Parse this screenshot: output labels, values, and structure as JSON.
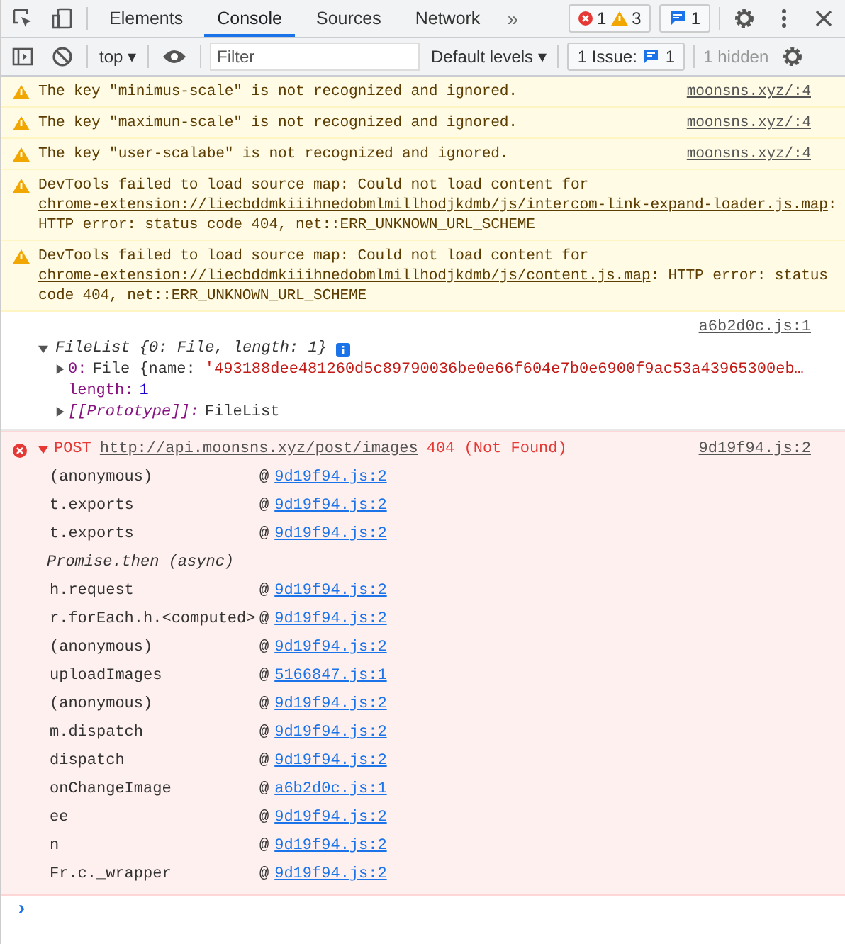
{
  "tabs": [
    {
      "label": "Elements",
      "selected": false
    },
    {
      "label": "Console",
      "selected": true
    },
    {
      "label": "Sources",
      "selected": false
    },
    {
      "label": "Network",
      "selected": false
    }
  ],
  "more_tabs": "»",
  "counters": {
    "errors": "1",
    "warnings": "3",
    "messages": "1"
  },
  "toolbar": {
    "context": "top",
    "context_caret": "▾",
    "filter_placeholder": "Filter",
    "levels": "Default levels",
    "levels_caret": "▾",
    "issues_label": "1 Issue:",
    "issues_count": "1",
    "hidden": "1 hidden"
  },
  "messages": [
    {
      "kind": "warning",
      "parts": [
        {
          "text": "The key \"minimus-scale\" is not recognized and ignored.",
          "link": false
        }
      ],
      "source": "moonsns.xyz/:4"
    },
    {
      "kind": "warning",
      "parts": [
        {
          "text": "The key \"maximun-scale\" is not recognized and ignored.",
          "link": false
        }
      ],
      "source": "moonsns.xyz/:4"
    },
    {
      "kind": "warning",
      "parts": [
        {
          "text": "The key \"user-scalabe\" is not recognized and ignored.",
          "link": false
        }
      ],
      "source": "moonsns.xyz/:4"
    },
    {
      "kind": "warning",
      "parts": [
        {
          "text": "DevTools failed to load source map: Could not load content for ",
          "link": false
        },
        {
          "text": "chrome-extension://",
          "link": true
        },
        {
          "text": "liecbddmkiiihnedobmlmillhodjkdmb/js/intercom-link-expand-loader.js.map",
          "link": true
        },
        {
          "text": ": HTTP error: status code 404, net::ERR_UNKNOWN_URL_SCHEME",
          "link": false
        }
      ]
    },
    {
      "kind": "warning",
      "parts": [
        {
          "text": "DevTools failed to load source map: Could not load content for ",
          "link": false
        },
        {
          "text": "chrome-extension://",
          "link": true
        },
        {
          "text": "liecbddmkiiihnedobmlmillhodjkdmb/js/content.js.map",
          "link": true
        },
        {
          "text": ": HTTP error: status code 404, net::ERR_UNKNOWN_URL_SCHEME",
          "link": false
        }
      ]
    },
    {
      "kind": "log",
      "source": "a6b2d0c.js:1",
      "object": {
        "title": "FileList {0: File, length: 1}",
        "expanded": true,
        "properties": [
          {
            "key": "0:",
            "value": "File {name: ",
            "string": "'493188dee481260d5c89790036be0e66f604e7b0e6900f9ac53a43965300eb…",
            "expandable": true,
            "italic": false
          },
          {
            "key": "length:",
            "number": "1",
            "expandable": false,
            "italic": false
          },
          {
            "key": "[[Prototype]]:",
            "value": "FileList",
            "expandable": true,
            "italic": true
          }
        ]
      }
    },
    {
      "kind": "error",
      "method": "POST",
      "url": "http://api.moonsns.xyz/post/images",
      "status": "404 (Not Found)",
      "source": "9d19f94.js:2",
      "expanded": true,
      "frames": [
        {
          "kind": "frame",
          "fn": "(anonymous)",
          "at": "@",
          "link": "9d19f94.js:2"
        },
        {
          "kind": "frame",
          "fn": "t.exports",
          "at": "@",
          "link": "9d19f94.js:2"
        },
        {
          "kind": "frame",
          "fn": "t.exports",
          "at": "@",
          "link": "9d19f94.js:2"
        },
        {
          "kind": "async",
          "text": "Promise.then (async)"
        },
        {
          "kind": "frame",
          "fn": "h.request",
          "at": "@",
          "link": "9d19f94.js:2"
        },
        {
          "kind": "frame",
          "fn": "r.forEach.h.<computed>",
          "at": "@",
          "link": "9d19f94.js:2"
        },
        {
          "kind": "frame",
          "fn": "(anonymous)",
          "at": "@",
          "link": "9d19f94.js:2"
        },
        {
          "kind": "frame",
          "fn": "uploadImages",
          "at": "@",
          "link": "5166847.js:1"
        },
        {
          "kind": "frame",
          "fn": "(anonymous)",
          "at": "@",
          "link": "9d19f94.js:2"
        },
        {
          "kind": "frame",
          "fn": "m.dispatch",
          "at": "@",
          "link": "9d19f94.js:2"
        },
        {
          "kind": "frame",
          "fn": "dispatch",
          "at": "@",
          "link": "9d19f94.js:2"
        },
        {
          "kind": "frame",
          "fn": "onChangeImage",
          "at": "@",
          "link": "a6b2d0c.js:1"
        },
        {
          "kind": "frame",
          "fn": "ee",
          "at": "@",
          "link": "9d19f94.js:2"
        },
        {
          "kind": "frame",
          "fn": "n",
          "at": "@",
          "link": "9d19f94.js:2"
        },
        {
          "kind": "frame",
          "fn": "Fr.c._wrapper",
          "at": "@",
          "link": "9d19f94.js:2"
        }
      ]
    }
  ],
  "prompt": "›"
}
